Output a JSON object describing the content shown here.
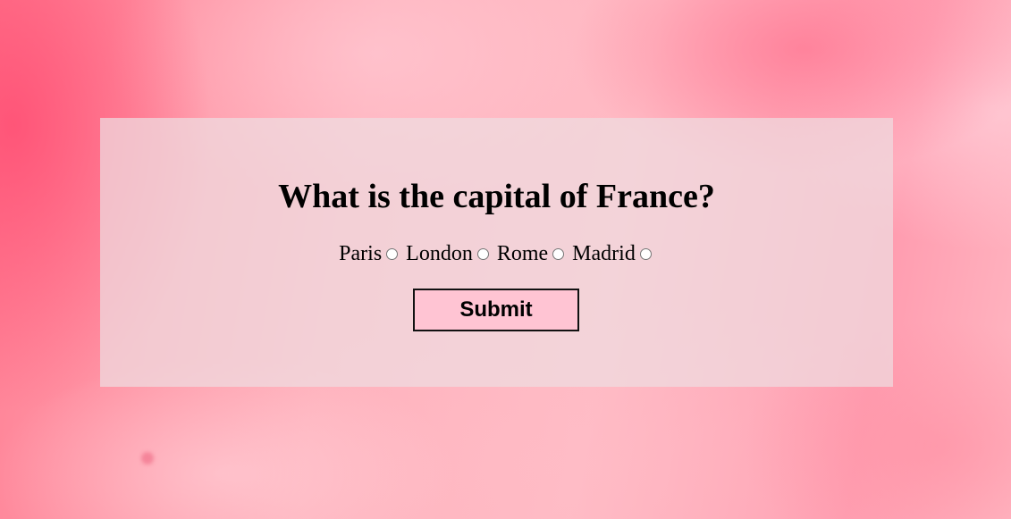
{
  "quiz": {
    "question": "What is the capital of France?",
    "options": [
      {
        "label": "Paris",
        "selected": false
      },
      {
        "label": "London",
        "selected": false
      },
      {
        "label": "Rome",
        "selected": false
      },
      {
        "label": "Madrid",
        "selected": false
      }
    ],
    "submit_label": "Submit"
  },
  "colors": {
    "panel_background": "#eedce1",
    "button_background": "#ffc4d3",
    "page_background": "#ff9aa8"
  }
}
